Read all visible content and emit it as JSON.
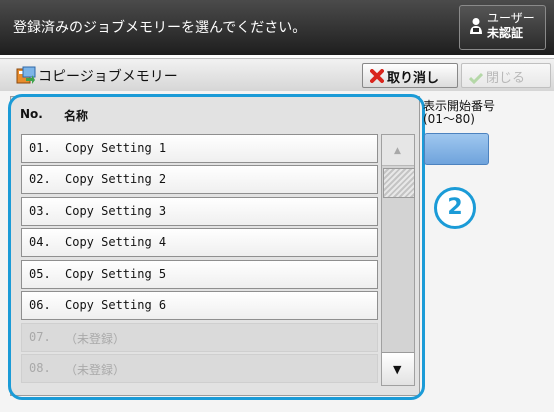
{
  "header": {
    "instruction": "登録済みのジョブメモリーを選んでください。",
    "user_button": {
      "line1": "ユーザー",
      "line2": "未認証"
    }
  },
  "subheader": {
    "title": "コピージョブメモリー",
    "cancel_label": "取り消し",
    "close_label": "閉じる"
  },
  "list": {
    "col_no": "No.",
    "col_name": "名称",
    "rows": [
      {
        "no": "01.",
        "name": "Copy Setting 1",
        "enabled": true
      },
      {
        "no": "02.",
        "name": "Copy Setting 2",
        "enabled": true
      },
      {
        "no": "03.",
        "name": "Copy Setting 3",
        "enabled": true
      },
      {
        "no": "04.",
        "name": "Copy Setting 4",
        "enabled": true
      },
      {
        "no": "05.",
        "name": "Copy Setting 5",
        "enabled": true
      },
      {
        "no": "06.",
        "name": "Copy Setting 6",
        "enabled": true
      },
      {
        "no": "07.",
        "name": "（未登録）",
        "enabled": false
      },
      {
        "no": "08.",
        "name": "（未登録）",
        "enabled": false
      }
    ]
  },
  "start_number": {
    "label": "表示開始番号",
    "range": "(01～80)",
    "value": ""
  },
  "step_badge": "2",
  "colors": {
    "accent": "#1b9bd7",
    "input": "#7fb1e4"
  },
  "icons": [
    "user-icon",
    "job-memory-icon",
    "cancel-x-icon",
    "check-icon",
    "scroll-up-arrow-icon",
    "scroll-down-arrow-icon"
  ]
}
